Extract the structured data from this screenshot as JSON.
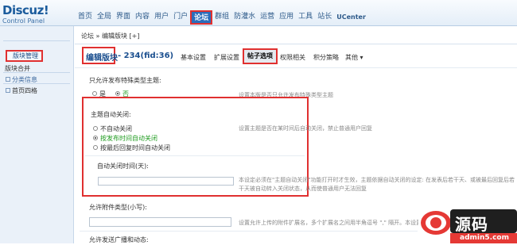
{
  "header": {
    "brand": "Discuz!",
    "sub": "Control Panel",
    "nav": [
      "首页",
      "全局",
      "界面",
      "内容",
      "用户",
      "门户",
      "论坛",
      "群组",
      "防灌水",
      "运营",
      "应用",
      "工具",
      "站长",
      "UCenter"
    ],
    "active_nav": "论坛"
  },
  "sidebar": {
    "items": [
      "版块管理",
      "版块合并"
    ],
    "active": "版块管理",
    "group": "分类信息",
    "after": "首页四格"
  },
  "crumb": "论坛 » 编辑版块  [+]",
  "title": {
    "name": "编辑版块",
    "id": " - 234(fid:36)"
  },
  "tabs": [
    "基本设置",
    "扩展设置",
    "帖子选项",
    "权限相关",
    "积分策略",
    "其他 ▾"
  ],
  "active_tab": "帖子选项",
  "sections": {
    "special_only": {
      "label": "只允许发布特殊类型主题:",
      "yes": "是",
      "no": "否",
      "hint": "设置本版是否只允许发布特殊类型主题"
    },
    "autoclose": {
      "label": "主题自动关闭:",
      "options": [
        "不自动关闭",
        "按发布时间自动关闭",
        "按最后回复时间自动关闭"
      ],
      "selected": "按发布时间自动关闭",
      "hint": "设置主题是否在某时间后自动关闭，禁止普通用户回复"
    },
    "autoclose_time": {
      "label": "自动关闭时间(天):",
      "hint": "本设定必须在\"主题自动关闭\"功能打开时才生效，主题依据自动关闭的设定: 在发表后若干天、或被最后回复后若干天被自动转入关闭状态，从而使普通用户无法回复"
    },
    "attach_types": {
      "label": "允许附件类型(小写):",
      "hint": "设置允许上传的附件扩展名，多个扩展名之间用半角逗号 \",\" 隔开。本设置的优先级"
    },
    "next": {
      "label": "允许发送广播和动态:"
    }
  },
  "watermark": {
    "text": "源码",
    "site": "admin5.com"
  }
}
